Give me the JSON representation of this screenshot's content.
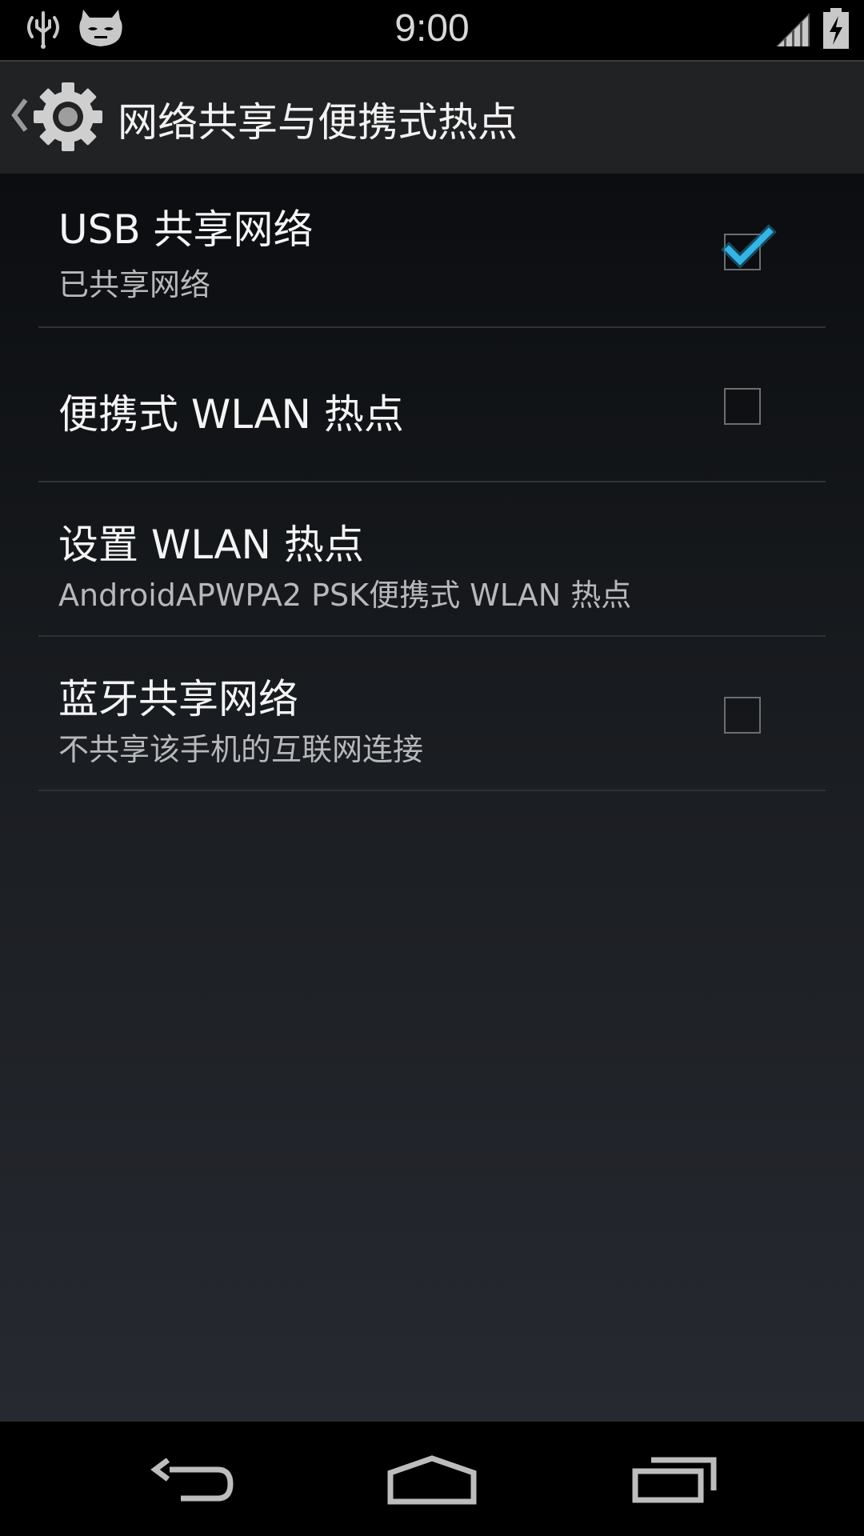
{
  "status_bar": {
    "time": "9:00",
    "icons": [
      "usb-debug-icon",
      "cyanogenmod-mascot-icon",
      "signal-icon",
      "battery-charging-icon"
    ]
  },
  "action_bar": {
    "title": "网络共享与便携式热点",
    "icons": [
      "back-caret-icon",
      "settings-gear-icon"
    ]
  },
  "preferences": [
    {
      "title": "USB 共享网络",
      "summary": "已共享网络",
      "checkbox": true,
      "checked": true
    },
    {
      "title": "便携式 WLAN 热点",
      "summary": "",
      "checkbox": true,
      "checked": false
    },
    {
      "title": "设置 WLAN 热点",
      "summary": "AndroidAPWPA2 PSK便携式 WLAN 热点",
      "checkbox": false,
      "checked": false
    },
    {
      "title": "蓝牙共享网络",
      "summary": "不共享该手机的互联网连接",
      "checkbox": true,
      "checked": false
    }
  ],
  "nav_bar": {
    "icons": [
      "back-icon",
      "home-icon",
      "recents-icon"
    ]
  },
  "colors": {
    "accent": "#33b5e5",
    "status_bar_bg": "#000000",
    "action_bar_bg": "#212223"
  }
}
